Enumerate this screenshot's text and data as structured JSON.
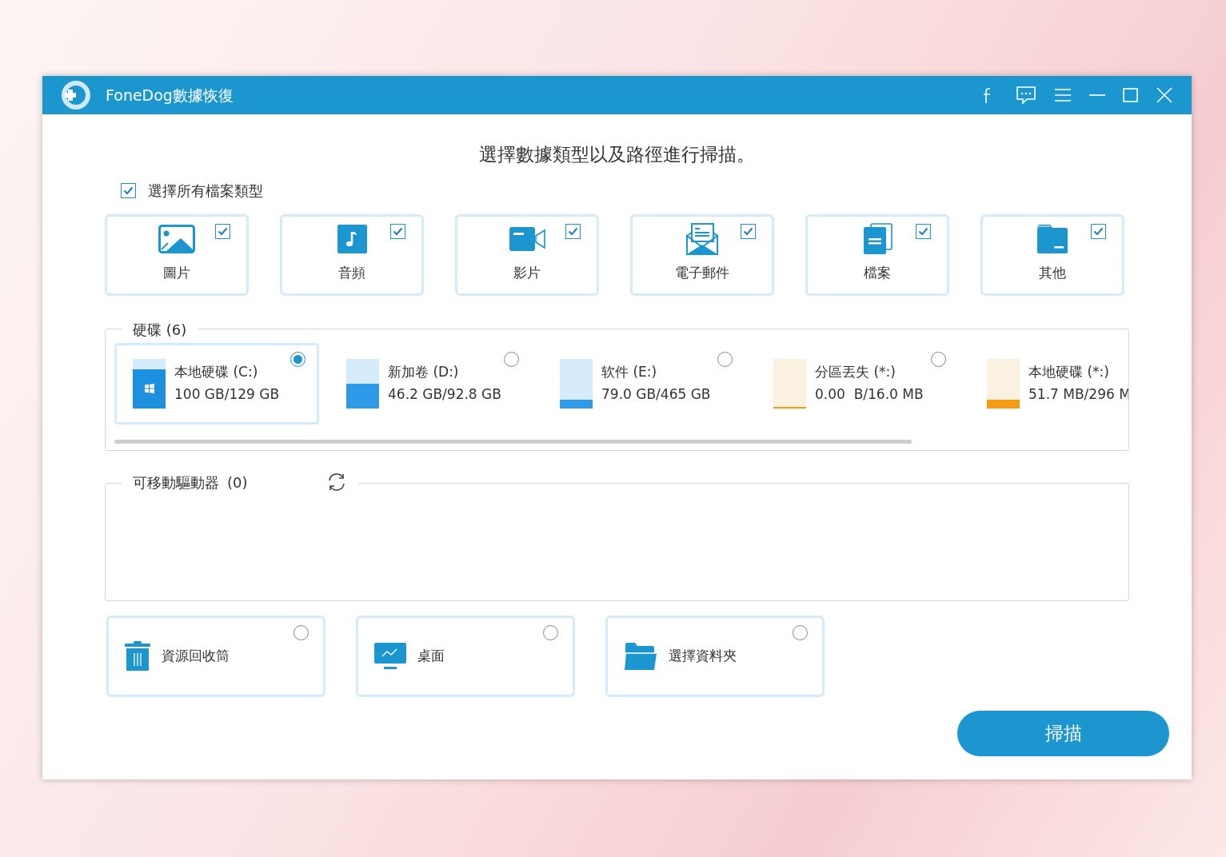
{
  "window": {
    "title": "FoneDog數據恢復"
  },
  "heading": "選擇數據類型以及路徑進行掃描。",
  "select_all": {
    "label": "選擇所有檔案類型",
    "checked": true
  },
  "file_types": [
    {
      "kind": "image",
      "label": "圖片",
      "checked": true
    },
    {
      "kind": "audio",
      "label": "音頻",
      "checked": true
    },
    {
      "kind": "video",
      "label": "影片",
      "checked": true
    },
    {
      "kind": "email",
      "label": "電子郵件",
      "checked": true
    },
    {
      "kind": "document",
      "label": "檔案",
      "checked": true
    },
    {
      "kind": "other",
      "label": "其他",
      "checked": true
    }
  ],
  "drives_section": {
    "title": "硬碟 (6)",
    "drives": [
      {
        "name": "本地硬碟 (C:)",
        "size": "100 GB/129 GB",
        "level": 0.775,
        "color": "#1e90e0",
        "system": true,
        "selected": true
      },
      {
        "name": "新加卷 (D:)",
        "size": "46.2 GB/92.8 GB",
        "level": 0.5,
        "color": "#2f9ae8",
        "system": false,
        "selected": false
      },
      {
        "name": "软件 (E:)",
        "size": "79.0 GB/465 GB",
        "level": 0.17,
        "color": "#2f9ae8",
        "system": false,
        "selected": false
      },
      {
        "name": "分區丟失 (*:)",
        "size": "0.00  B/16.0 MB",
        "level": 0.0,
        "color": "#f59c12",
        "system": false,
        "selected": false
      },
      {
        "name": "本地硬碟 (*:)",
        "size": "51.7 MB/296 M",
        "level": 0.17,
        "color": "#f59c12",
        "system": false,
        "selected": false
      }
    ]
  },
  "removable_section": {
    "title": "可移動驅動器",
    "count": "(0)"
  },
  "locations": [
    {
      "kind": "recycle",
      "label": "資源回收筒",
      "selected": false
    },
    {
      "kind": "desktop",
      "label": "桌面",
      "selected": false
    },
    {
      "kind": "folder",
      "label": "選擇資料夾",
      "selected": false
    }
  ],
  "scan_button": "掃描"
}
